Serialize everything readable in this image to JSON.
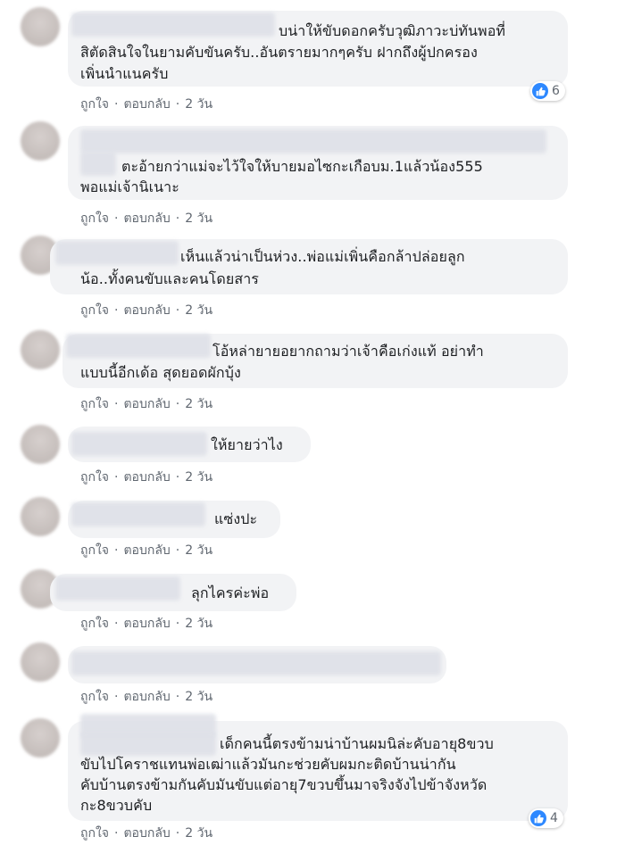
{
  "actions": {
    "like": "ถูกใจ",
    "reply": "ตอบกลับ",
    "time": "2 วัน",
    "separator": "·"
  },
  "colors": {
    "like_blue": "#2d88ff",
    "bubble": "#f2f3f5",
    "meta": "#606770"
  },
  "comments": [
    {
      "lines": [
        "บน่าให้ขับดอกครับวุฒิภาวะบ่ทันพอที่",
        "สิตัดสินใจในยามคับขันครับ..อันตรายมากๆครับ ฝากถึงผู้ปกครอง",
        "เพิ่นนำแนครับ"
      ],
      "reaction_icon": "like-icon",
      "reaction_count": "6"
    },
    {
      "lines": [
        "ตะอ้ายกว่าแม่จะไว้ใจให้บายมอไซกะเกือบม.1แล้วน้อง555",
        "พอแม่เจ้านิเนาะ"
      ]
    },
    {
      "lines": [
        "เห็นแล้วน่าเป็นห่วง..พ่อแม่เพิ่นคือกล้าปล่อยลูก",
        "น้อ..ทั้งคนขับและคนโดยสาร"
      ]
    },
    {
      "lines": [
        "โอ้หล่ายายอยากถามว่าเจ้าคือเก่งแท้ อย่าทำ",
        "แบบนี้อีกเด้อ สุดยอดผักบุ้ง"
      ]
    },
    {
      "lines": [
        "ให้ยายว่าไง"
      ]
    },
    {
      "lines": [
        "แซ่งปะ"
      ]
    },
    {
      "lines": [
        "ลุกไครค่ะพ่อ"
      ]
    },
    {
      "lines": []
    },
    {
      "lines": [
        "เด็กคนนี้ตรงข้ามน่าบ้านผมนิล่ะคับอายุ8ขวบ",
        "ขับไปโคราชแทนพ่อเฒ่าแล้วมันกะช่วยคับผมกะติดบ้านน่ากัน",
        "คับบ้านตรงข้ามกันคับมันขับแต่อายุ7ขวบขึ้นมาจริงจังไปข้าจังหวัด",
        "กะ8ขวบคับ"
      ],
      "reaction_icon": "like-icon",
      "reaction_count": "4"
    }
  ]
}
